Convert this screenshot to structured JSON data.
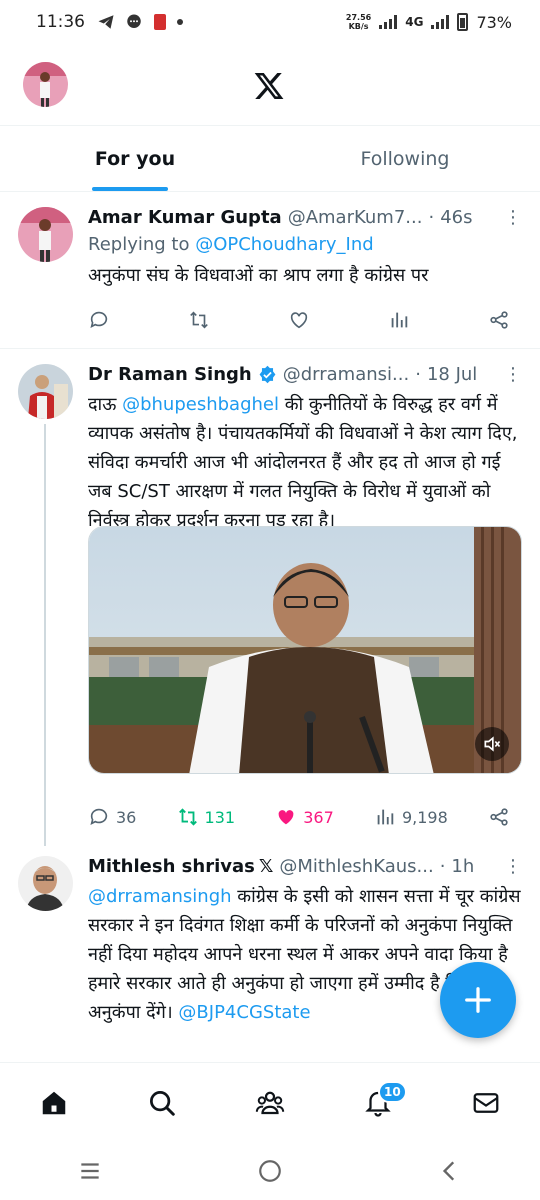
{
  "status_bar": {
    "time": "11:36",
    "net_speed_value": "27.56",
    "net_speed_unit": "KB/s",
    "network": "4G",
    "battery": "73%",
    "icons": [
      "telegram-icon",
      "chat-bubble-icon",
      "app-red-icon",
      "dot-icon"
    ]
  },
  "header": {
    "logo": "x-logo-icon",
    "avatar": "profile-avatar"
  },
  "tabs": [
    {
      "label": "For you",
      "active": true
    },
    {
      "label": "Following",
      "active": false
    }
  ],
  "tweets": [
    {
      "name": "Amar Kumar Gupta",
      "handle": "@AmarKum7...",
      "time": "46s",
      "reply_prefix": "Replying to ",
      "reply_handle": "@OPChoudhary_Ind",
      "text": "अनुकंपा संघ के विधवाओं का श्राप लगा है कांग्रेस पर",
      "actions": {
        "replies": "",
        "reposts": "",
        "likes": "",
        "views": ""
      }
    },
    {
      "name": "Dr Raman Singh",
      "handle": "@drramansi...",
      "time": "18 Jul",
      "verified": true,
      "text_prefix": "दाऊ ",
      "text_mention": "@bhupeshbaghel",
      "text": " की कुनीतियों के विरुद्ध हर वर्ग में व्यापक असंतोष है। पंचायतकर्मियों की विधवाओं ने केश त्याग दिए, संविदा कमर्चारी आज भी आंदोलनरत हैं और हद तो आज हो गई जब SC/ST आरक्षण में गलत नियुक्ति के विरोध में युवाओं को निर्वस्त्र होकर प्रदर्शन करना पड़ रहा है।",
      "actions": {
        "replies": "36",
        "reposts": "131",
        "likes": "367",
        "views": "9,198"
      },
      "reposted_color": "#00ba7c",
      "liked_color": "#f91880"
    },
    {
      "name": "Mithlesh shrivas",
      "badge": "𝕏",
      "handle": "@MithleshKaus...",
      "time": "1h",
      "text_mention": "@drramansingh",
      "text": " कांग्रेस के इसी को शासन सत्ता में चूर कांग्रेस सरकार ने इन दिवंगत शिक्षा कर्मी के परिजनों को अनुकंपा नियुक्ति नहीं दिया महोदय आपने धरना स्थल में आकर अपने वादा किया है हमारे सरकार आते ही अनुकंपा हो जाएगा हमें उम्मीद है कि आप अनुकंपा देंगे। ",
      "text_mention_end": "@BJP4CGState"
    }
  ],
  "bottom_nav": {
    "items": [
      "home-icon",
      "search-icon",
      "communities-icon",
      "notifications-icon",
      "messages-icon"
    ],
    "notif_count": "10"
  },
  "colors": {
    "accent": "#1d9bf0",
    "text": "#0f1419",
    "secondary": "#536471"
  }
}
